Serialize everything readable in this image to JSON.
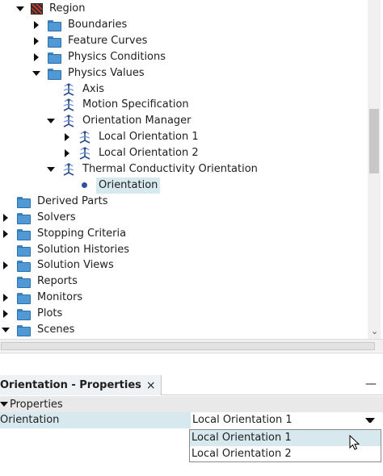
{
  "tree": {
    "rows": [
      {
        "label": "Region",
        "twisty": "exp",
        "icon": "region-icon",
        "indent": 18
      },
      {
        "label": "Boundaries",
        "twisty": "col",
        "icon": "folder-icon",
        "indent": 38
      },
      {
        "label": "Feature Curves",
        "twisty": "col",
        "icon": "folder-icon",
        "indent": 38
      },
      {
        "label": "Physics Conditions",
        "twisty": "col",
        "icon": "folder-icon",
        "indent": 38
      },
      {
        "label": "Physics Values",
        "twisty": "exp",
        "icon": "folder-icon",
        "indent": 38
      },
      {
        "label": "Axis",
        "twisty": "none",
        "icon": "orientation-icon",
        "indent": 56
      },
      {
        "label": "Motion Specification",
        "twisty": "none",
        "icon": "orientation-icon",
        "indent": 56
      },
      {
        "label": "Orientation Manager",
        "twisty": "exp",
        "icon": "orientation-icon",
        "indent": 56
      },
      {
        "label": "Local Orientation 1",
        "twisty": "col",
        "icon": "orientation-icon",
        "indent": 76
      },
      {
        "label": "Local Orientation 2",
        "twisty": "col",
        "icon": "orientation-icon",
        "indent": 76
      },
      {
        "label": "Thermal Conductivity Orientation",
        "twisty": "exp",
        "icon": "orientation-icon",
        "indent": 56
      },
      {
        "label": "Orientation",
        "twisty": "none",
        "icon": "dot-icon",
        "indent": 76,
        "selected": true
      },
      {
        "label": "Derived Parts",
        "twisty": "none",
        "icon": "folder-icon",
        "indent": 0
      },
      {
        "label": "Solvers",
        "twisty": "col",
        "icon": "folder-icon",
        "indent": 0
      },
      {
        "label": "Stopping Criteria",
        "twisty": "col",
        "icon": "folder-icon",
        "indent": 0
      },
      {
        "label": "Solution Histories",
        "twisty": "none",
        "icon": "folder-icon",
        "indent": 0
      },
      {
        "label": "Solution Views",
        "twisty": "col",
        "icon": "folder-icon",
        "indent": 0
      },
      {
        "label": "Reports",
        "twisty": "none",
        "icon": "folder-icon",
        "indent": 0
      },
      {
        "label": "Monitors",
        "twisty": "col",
        "icon": "folder-icon",
        "indent": 0
      },
      {
        "label": "Plots",
        "twisty": "col",
        "icon": "folder-icon",
        "indent": 0
      },
      {
        "label": "Scenes",
        "twisty": "exp",
        "icon": "folder-icon",
        "indent": 0
      }
    ]
  },
  "properties": {
    "tab_title": "Orientation - Properties",
    "close_glyph": "×",
    "minimize_glyph": "—",
    "section_label": "Properties",
    "row_key": "Orientation",
    "row_value": "Local Orientation 1",
    "options": [
      "Local Orientation 1",
      "Local Orientation 2"
    ],
    "highlighted_option": 0
  },
  "scrollbar": {
    "down_glyph": "⌄"
  }
}
